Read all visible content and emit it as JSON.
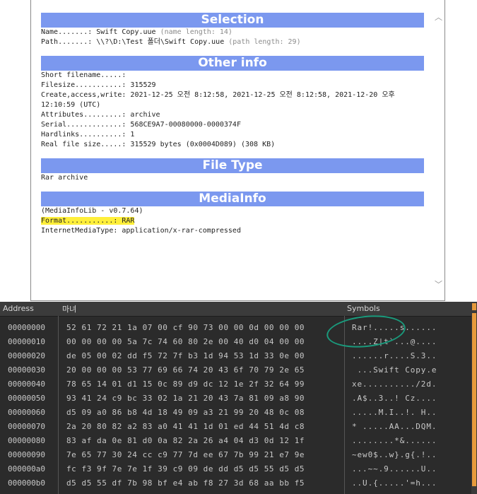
{
  "selection": {
    "title": "Selection",
    "name_line": "Name.......: Swift Copy.uue ",
    "name_note": "(name length: 14)",
    "path_line": "Path.......: \\\\?\\D:\\Test 폴더\\Swift Copy.uue ",
    "path_note": "(path length: 29)"
  },
  "other_info": {
    "title": "Other info",
    "short_filename": "Short filename.....:",
    "filesize": "Filesize...........: 315529",
    "timestamps": "Create,access,write: 2021-12-25 오전 8:12:58, 2021-12-25 오전 8:12:58, 2021-12-20 오후 12:10:59 (UTC)",
    "attributes": "Attributes.........: archive",
    "serial": "Serial.............: 568CE9A7-00080000-0000374F",
    "hardlinks": "Hardlinks..........: 1",
    "real_size": "Real file size.....: 315529 bytes (0x0004D089) (308 KB)"
  },
  "file_type": {
    "title": "File Type",
    "value": "Rar archive"
  },
  "media_info": {
    "title": "MediaInfo",
    "lib": "(MediaInfoLib - v0.7.64)",
    "format": "Format...........: RAR",
    "mime": "InternetMediaType: application/x-rar-compressed"
  },
  "scroll": {
    "up_icon": "chevron-up-icon",
    "down_icon": "chevron-down-icon"
  },
  "hex": {
    "header_address": "Address",
    "header_hex": "마녀",
    "header_symbols": "Symbols",
    "rows": [
      {
        "addr": "00000000",
        "bytes": "52 61 72 21 1a 07 00 cf 90 73 00 00 0d 00 00 00",
        "syms": "Rar!.....s......"
      },
      {
        "addr": "00000010",
        "bytes": "00 00 00 00 5a 7c 74 60 80 2e 00 40 d0 04 00 00",
        "syms": "....Z|t`...@...."
      },
      {
        "addr": "00000020",
        "bytes": "de 05 00 02 dd f5 72 7f b3 1d 94 53 1d 33 0e 00",
        "syms": "......r....S.3.."
      },
      {
        "addr": "00000030",
        "bytes": "20 00 00 00 53 77 69 66 74 20 43 6f 70 79 2e 65",
        "syms": " ...Swift Copy.e"
      },
      {
        "addr": "00000040",
        "bytes": "78 65 14 01 d1 15 0c 89 d9 dc 12 1e 2f 32 64 99",
        "syms": "xe........../2d."
      },
      {
        "addr": "00000050",
        "bytes": "93 41 24 c9 bc 33 02 1a 21 20 43 7a 81 09 a8 90",
        "syms": ".A$..3..! Cz...."
      },
      {
        "addr": "00000060",
        "bytes": "d5 09 a0 86 b8 4d 18 49 09 a3 21 99 20 48 0c 08",
        "syms": ".....M.I..!. H.."
      },
      {
        "addr": "00000070",
        "bytes": "2a 20 80 82 a2 83 a0 41 41 1d 01 ed 44 51 4d c8",
        "syms": "* .....AA...DQM."
      },
      {
        "addr": "00000080",
        "bytes": "83 af da 0e 81 d0 0a 82 2a 26 a4 04 d3 0d 12 1f",
        "syms": "........*&......"
      },
      {
        "addr": "00000090",
        "bytes": "7e 65 77 30 24 cc c9 77 7d ee 67 7b 99 21 e7 9e",
        "syms": "~ew0$..w}.g{.!.."
      },
      {
        "addr": "000000a0",
        "bytes": "fc f3 9f 7e 7e 1f 39 c9 09 de dd d5 d5 55 d5 d5",
        "syms": "...~~.9......U.."
      },
      {
        "addr": "000000b0",
        "bytes": "d5 d5 55 df 7b 98 bf e4 ab f8 27 3d 68 aa bb f5",
        "syms": "..U.{.....'=h..."
      }
    ]
  },
  "colors": {
    "section_header": "#7b98ef",
    "highlight": "#ffef3a",
    "hex_background": "#2b2b2b",
    "scroll_accent": "#e69a3c",
    "annotation": "#1a9a7c"
  }
}
